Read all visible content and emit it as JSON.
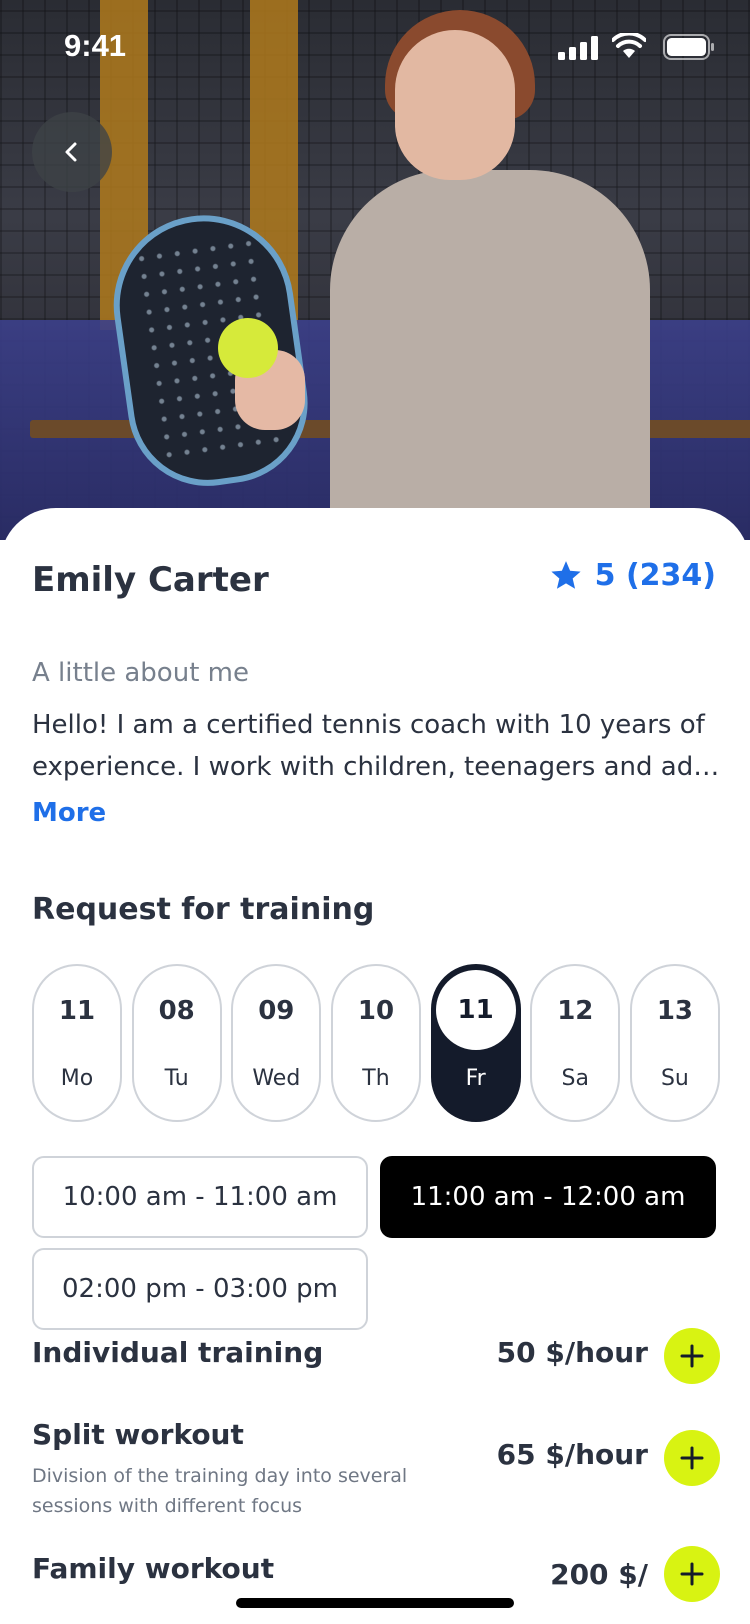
{
  "status_bar": {
    "time": "9:41"
  },
  "hero": {
    "photo": "coach-photo-holding-padel-racket-and-ball"
  },
  "coach": {
    "name": "Emily Carter",
    "rating": "5 (234)",
    "about_label": "A little about me",
    "about_line1": "Hello! I am a certified tennis coach with 10 years of",
    "about_line2": "experience. I work with children, teenagers and adul…",
    "more_label": "More"
  },
  "training": {
    "title": "Request for training",
    "days": [
      {
        "num": "11",
        "weekday": "Mo"
      },
      {
        "num": "08",
        "weekday": "Tu"
      },
      {
        "num": "09",
        "weekday": "Wed"
      },
      {
        "num": "10",
        "weekday": "Th"
      },
      {
        "num": "11",
        "weekday": "Fr",
        "selected": true
      },
      {
        "num": "12",
        "weekday": "Sa"
      },
      {
        "num": "13",
        "weekday": "Su"
      }
    ],
    "slots": [
      {
        "label": "10:00 am - 11:00 am"
      },
      {
        "label": "11:00 am - 12:00 am",
        "selected": true
      },
      {
        "label": "02:00 pm - 03:00 pm"
      }
    ]
  },
  "services": [
    {
      "title": "Individual training",
      "price": "50 $/hour"
    },
    {
      "title": "Split workout",
      "desc": "Division of the training day into several sessions with different focus",
      "price": "65 $/hour"
    },
    {
      "title": "Family workout",
      "price": "200 $/"
    }
  ],
  "colors": {
    "accent_blue": "#1f6fe8",
    "add_button": "#d8f312",
    "selected_day": "#141b2b",
    "selected_slot": "#000000"
  }
}
